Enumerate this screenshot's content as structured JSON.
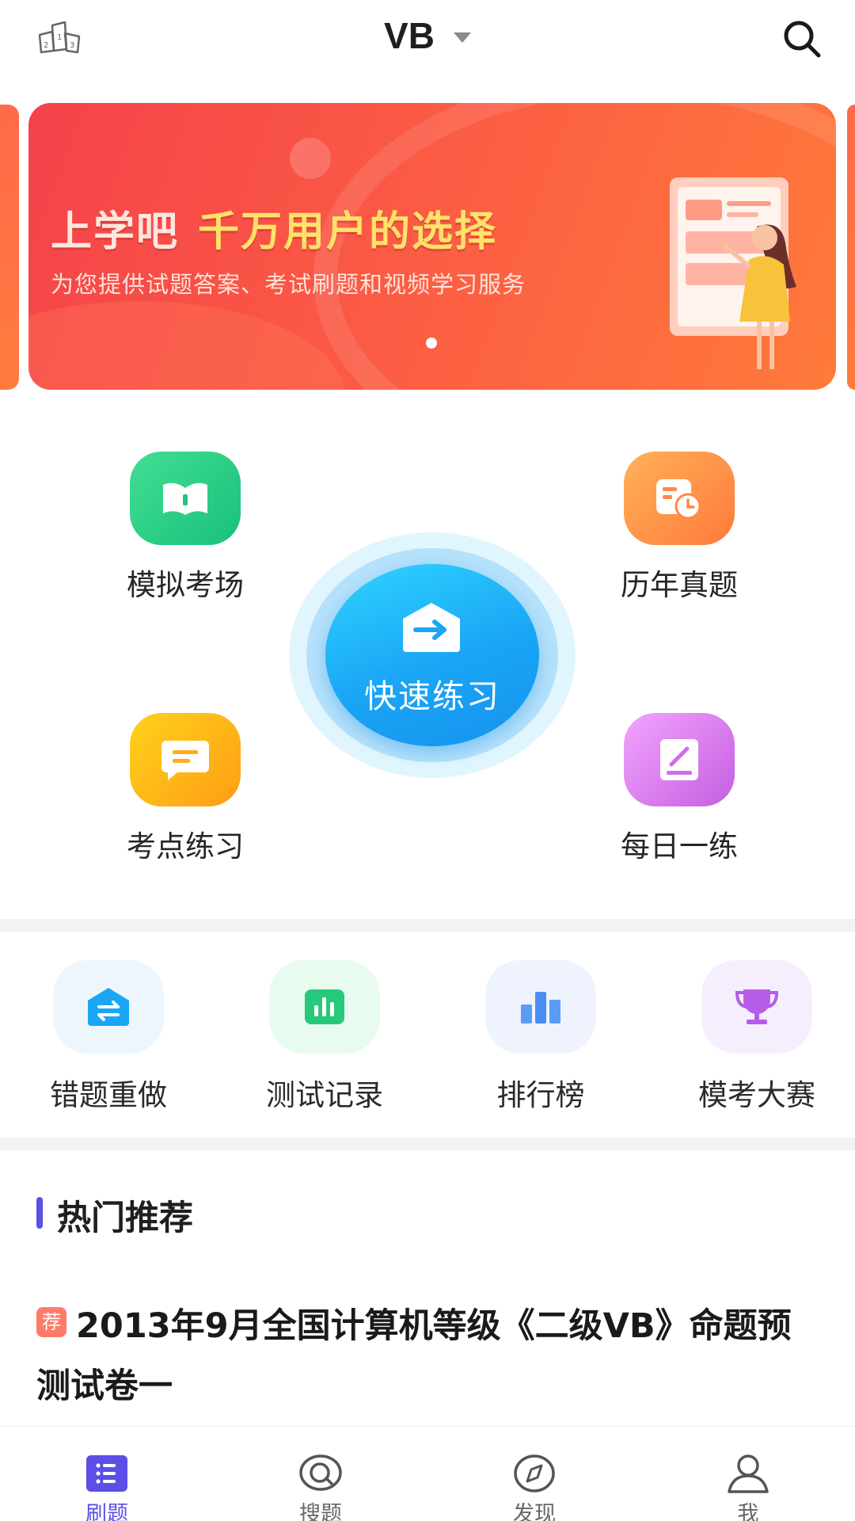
{
  "header": {
    "subject": "VB",
    "rank_icon": "ranking-podium-icon",
    "search_icon": "search-icon"
  },
  "banner": {
    "title_part1": "上学吧",
    "title_part2": "千万用户的选择",
    "subtitle": "为您提供试题答案、考试刷题和视频学习服务"
  },
  "features": {
    "mock_exam": "模拟考场",
    "past_papers": "历年真题",
    "quick_practice": "快速练习",
    "point_practice": "考点练习",
    "daily_practice": "每日一练"
  },
  "tools": [
    {
      "label": "错题重做",
      "icon": "redo-swap-icon"
    },
    {
      "label": "测试记录",
      "icon": "record-chart-icon"
    },
    {
      "label": "排行榜",
      "icon": "leaderboard-icon"
    },
    {
      "label": "模考大赛",
      "icon": "trophy-icon"
    }
  ],
  "hot": {
    "title": "热门推荐",
    "badge": "荐",
    "item_title": "2013年9月全国计算机等级《二级VB》命题预测试卷一"
  },
  "tabbar": {
    "tabs": [
      {
        "label": "刷题",
        "icon": "list-icon",
        "active": true
      },
      {
        "label": "搜题",
        "icon": "search-question-icon",
        "active": false
      },
      {
        "label": "发现",
        "icon": "compass-icon",
        "active": false
      },
      {
        "label": "我",
        "icon": "user-icon",
        "active": false
      }
    ]
  },
  "colors": {
    "accent": "#5b4fe6",
    "banner": "#f4424a",
    "quick": "#1aa5f5"
  }
}
